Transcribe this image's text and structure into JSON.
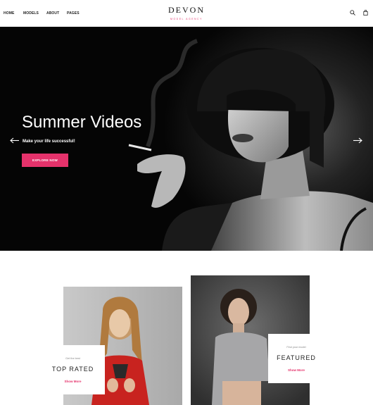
{
  "header": {
    "nav": [
      "HOME",
      "MODELS",
      "ABOUT",
      "PAGES"
    ],
    "logo": "DEVON",
    "tagline": "MODEL AGENCY",
    "icons": [
      "search-icon",
      "shopping-bag-icon"
    ]
  },
  "hero": {
    "title": "Summer Videos",
    "subtitle": "Make your life successful!",
    "button": "EXPLORE NOW",
    "icons": [
      "arrow-left-icon",
      "arrow-right-icon"
    ]
  },
  "cards": [
    {
      "small": "Get the best",
      "title": "TOP RATED",
      "link": "Show More"
    },
    {
      "small": "Find your model",
      "title": "FEATURED",
      "link": "Show More"
    }
  ],
  "colors": {
    "accent": "#e5326b",
    "hero_bg": "#050505"
  }
}
